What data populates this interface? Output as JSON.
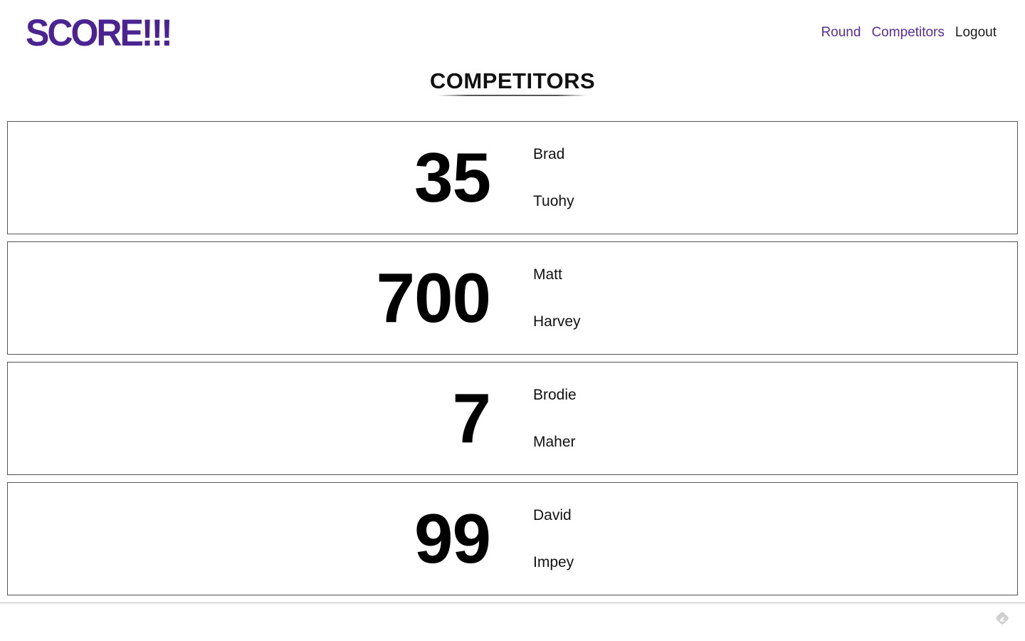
{
  "header": {
    "logo_text": "SCORE!!!",
    "nav": {
      "round_label": "Round",
      "competitors_label": "Competitors",
      "logout_label": "Logout"
    }
  },
  "main": {
    "title": "COMPETITORS",
    "competitors": [
      {
        "score": "35",
        "first_name": "Brad",
        "last_name": "Tuohy"
      },
      {
        "score": "700",
        "first_name": "Matt",
        "last_name": "Harvey"
      },
      {
        "score": "7",
        "first_name": "Brodie",
        "last_name": "Maher"
      },
      {
        "score": "99",
        "first_name": "David",
        "last_name": "Impey"
      }
    ]
  },
  "colors": {
    "brand": "#4b2491",
    "nav_link": "#5a2d9c",
    "card_border": "#555555"
  },
  "icons": {
    "corner": "feedback-icon"
  }
}
